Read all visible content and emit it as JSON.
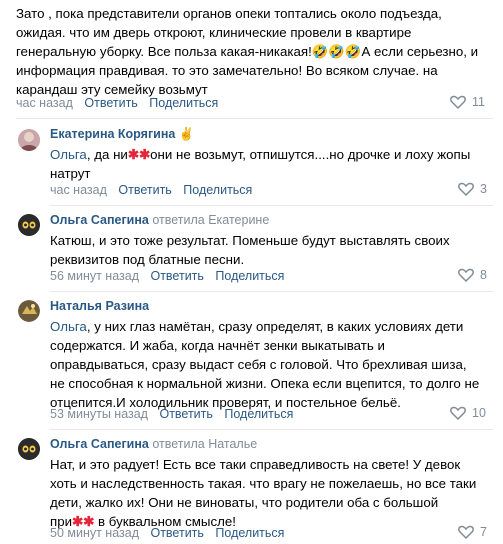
{
  "top": {
    "text": "Зато , пока представители органов опеки топтались около подъезда, ожидая. что им дверь откроют, клинические провели в квартире генеральную уборку. Все польза какая-никакая!🤣🤣🤣А если серьезно, и информация правдивая. то это замечательно! Во всяком случае. на карандаш эту семейку возьмут",
    "time": "час назад",
    "reply": "Ответить",
    "share": "Поделиться",
    "likes": "11"
  },
  "comments": [
    {
      "name": "Екатерина Корягина",
      "badge": "✌",
      "replied": "",
      "mention": "Ольга",
      "text_before": ", да ни",
      "text_after": "они не возьмут, отпишутся....но дрочке и лоху жопы натрут",
      "time": "час назад",
      "reply": "Ответить",
      "share": "Поделиться",
      "likes": "3"
    },
    {
      "name": "Ольга Сапегина",
      "replied": "ответила Екатерине",
      "text": "Катюш, и это тоже результат. Поменьше будут выставлять своих реквизитов под блатные песни.",
      "time": "56 минут назад",
      "reply": "Ответить",
      "share": "Поделиться",
      "likes": "8"
    },
    {
      "name": "Наталья Разина",
      "replied": "",
      "mention": "Ольга",
      "text": ", у них глаз намётан, сразу определят, в каких условиях дети содержатся. И жаба, когда начнёт зенки выкатывать и оправдываться, сразу выдаст себя с головой. Что брехливая шиза, не способная к нормальной жизни. Опека если вцепится, то долго не отцепится.И холодильник проверят, и постельное бельё.",
      "time": "53 минуты назад",
      "reply": "Ответить",
      "share": "Поделиться",
      "likes": "10"
    },
    {
      "name": "Ольга Сапегина",
      "replied": "ответила Наталье",
      "text_before": "Нат, и это радует! Есть все таки справедливость на свете! У девок хоть и наследственность такая. что врагу не пожелаешь, но все таки дети, жалко их! Они не виноваты, что родители оба с большой при",
      "text_after": " в буквальном смысле!",
      "time": "50 минут назад",
      "reply": "Ответить",
      "share": "Поделиться",
      "likes": "7"
    }
  ]
}
